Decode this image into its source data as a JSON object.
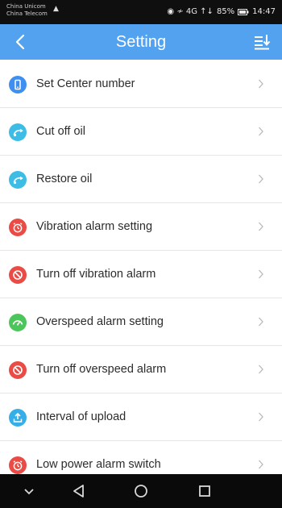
{
  "status_bar": {
    "carrier_top": "China Unicom",
    "carrier_bottom": "China Telecom",
    "indicators": "◉ ≁ 4G ↑↓",
    "battery": "85%",
    "time": "14:47"
  },
  "header": {
    "title": "Setting",
    "back_icon": "back-arrow-icon",
    "sort_icon": "sort-list-icon"
  },
  "menu": {
    "items": [
      {
        "label": "Set Center number",
        "icon": "phone-icon",
        "color": "#3f8ff0"
      },
      {
        "label": "Cut off oil",
        "icon": "oil-icon",
        "color": "#3dbce6"
      },
      {
        "label": "Restore oil",
        "icon": "oil-icon",
        "color": "#3dbce6"
      },
      {
        "label": "Vibration alarm setting",
        "icon": "alarm-clock-icon",
        "color": "#ea4b45"
      },
      {
        "label": "Turn off vibration alarm",
        "icon": "block-icon",
        "color": "#ea4b45"
      },
      {
        "label": "Overspeed alarm setting",
        "icon": "gauge-icon",
        "color": "#4cc65a"
      },
      {
        "label": "Turn off overspeed alarm",
        "icon": "block-icon",
        "color": "#ea4b45"
      },
      {
        "label": "Interval of upload",
        "icon": "upload-icon",
        "color": "#36aee8"
      },
      {
        "label": "Low power alarm switch",
        "icon": "alarm-clock-icon",
        "color": "#ea4b45"
      }
    ]
  },
  "nav_bar": {
    "buttons": [
      "hide-keyboard-icon",
      "back-triangle-icon",
      "home-circle-icon",
      "recents-square-icon"
    ]
  },
  "colors": {
    "accent": "#52a2f0",
    "status_bar": "#0f0f0f",
    "nav_bar": "#0a0a0a"
  }
}
